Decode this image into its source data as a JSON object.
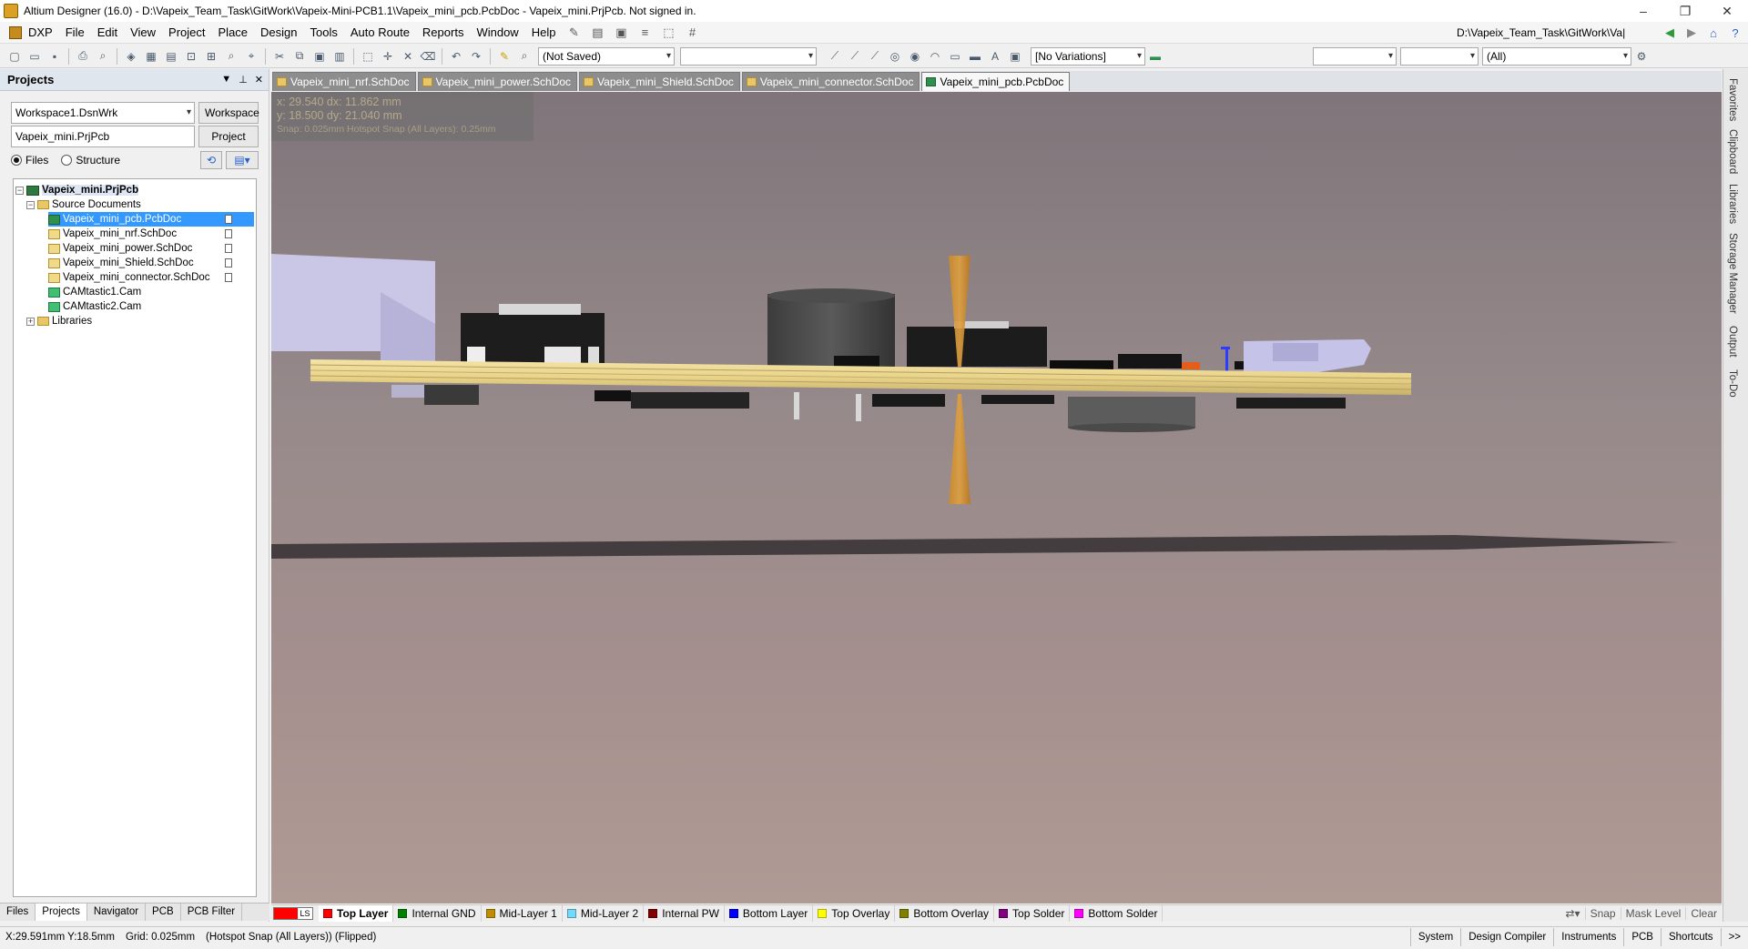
{
  "window": {
    "title": "Altium Designer (16.0) - D:\\Vapeix_Team_Task\\GitWork\\Vapeix-Mini-PCB1.1\\Vapeix_mini_pcb.PcbDoc - Vapeix_mini.PrjPcb. Not signed in.",
    "minimize": "–",
    "restore": "❐",
    "close": "✕"
  },
  "menu": {
    "items": [
      "DXP",
      "File",
      "Edit",
      "View",
      "Project",
      "Place",
      "Design",
      "Tools",
      "Auto Route",
      "Reports",
      "Window",
      "Help"
    ],
    "path": "D:\\Vapeix_Team_Task\\GitWork\\Va|"
  },
  "toolbar": {
    "saved_state": "(Not Saved)",
    "variations": "[No Variations]",
    "filter_all": "(All)"
  },
  "projects_panel": {
    "title": "Projects",
    "workspace_value": "Workspace1.DsnWrk",
    "workspace_button": "Workspace",
    "project_value": "Vapeix_mini.PrjPcb",
    "project_button": "Project",
    "radio_files": "Files",
    "radio_structure": "Structure",
    "tree": {
      "project": "Vapeix_mini.PrjPcb",
      "source_folder": "Source Documents",
      "documents": [
        "Vapeix_mini_pcb.PcbDoc",
        "Vapeix_mini_nrf.SchDoc",
        "Vapeix_mini_power.SchDoc",
        "Vapeix_mini_Shield.SchDoc",
        "Vapeix_mini_connector.SchDoc",
        "CAMtastic1.Cam",
        "CAMtastic2.Cam"
      ],
      "libraries": "Libraries"
    },
    "tabs": [
      "Files",
      "Projects",
      "Navigator",
      "PCB",
      "PCB Filter"
    ]
  },
  "doc_tabs": [
    "Vapeix_mini_nrf.SchDoc",
    "Vapeix_mini_power.SchDoc",
    "Vapeix_mini_Shield.SchDoc",
    "Vapeix_mini_connector.SchDoc",
    "Vapeix_mini_pcb.PcbDoc"
  ],
  "viewport": {
    "coord_line1": "x: 29.540   dx: 11.862 mm",
    "coord_line2": "y: 18.500   dy: 21.040 mm",
    "coord_line3": "Snap: 0.025mm Hotspot Snap (All Layers): 0.25mm"
  },
  "right_dock": [
    "Favorites",
    "Clipboard",
    "Libraries",
    "Storage Manager",
    "Output",
    "To-Do"
  ],
  "layers": {
    "ls_label": "LS",
    "items": [
      {
        "name": "Top Layer",
        "color": "#ff0000"
      },
      {
        "name": "Internal GND",
        "color": "#008000"
      },
      {
        "name": "Mid-Layer 1",
        "color": "#bc8e00"
      },
      {
        "name": "Mid-Layer 2",
        "color": "#70dbfa"
      },
      {
        "name": "Internal PW",
        "color": "#800000"
      },
      {
        "name": "Bottom Layer",
        "color": "#0000ff"
      },
      {
        "name": "Top Overlay",
        "color": "#ffff00"
      },
      {
        "name": "Bottom Overlay",
        "color": "#808000"
      },
      {
        "name": "Top Solder",
        "color": "#800080"
      },
      {
        "name": "Bottom Solder",
        "color": "#ff00ff"
      }
    ],
    "right": [
      "Snap",
      "Mask Level",
      "Clear"
    ]
  },
  "status": {
    "coords": "X:29.591mm Y:18.5mm",
    "grid": "Grid: 0.025mm",
    "snap": "(Hotspot Snap (All Layers)) (Flipped)",
    "right": [
      "System",
      "Design Compiler",
      "Instruments",
      "PCB",
      "Shortcuts"
    ],
    "overflow": ">>"
  }
}
